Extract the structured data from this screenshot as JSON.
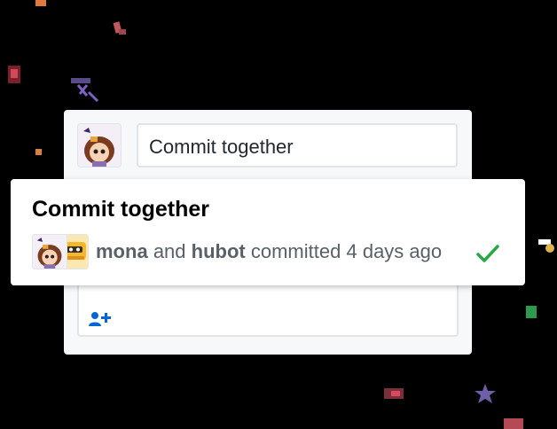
{
  "background": "#000000",
  "editor": {
    "commit_message_value": "Commit together",
    "author_avatar": "mona-avatar",
    "add_coauthor_icon": "add-person-icon"
  },
  "commit": {
    "title": "Commit together",
    "author_1": "mona",
    "connector": "and",
    "author_2": "hubot",
    "action": "committed",
    "time": "4 days ago",
    "status_icon": "checkmark-icon",
    "status_color": "#28a745"
  },
  "colors": {
    "card_bg": "#f6f8fa",
    "accent_blue": "#0366d6",
    "text_muted": "#586069"
  }
}
